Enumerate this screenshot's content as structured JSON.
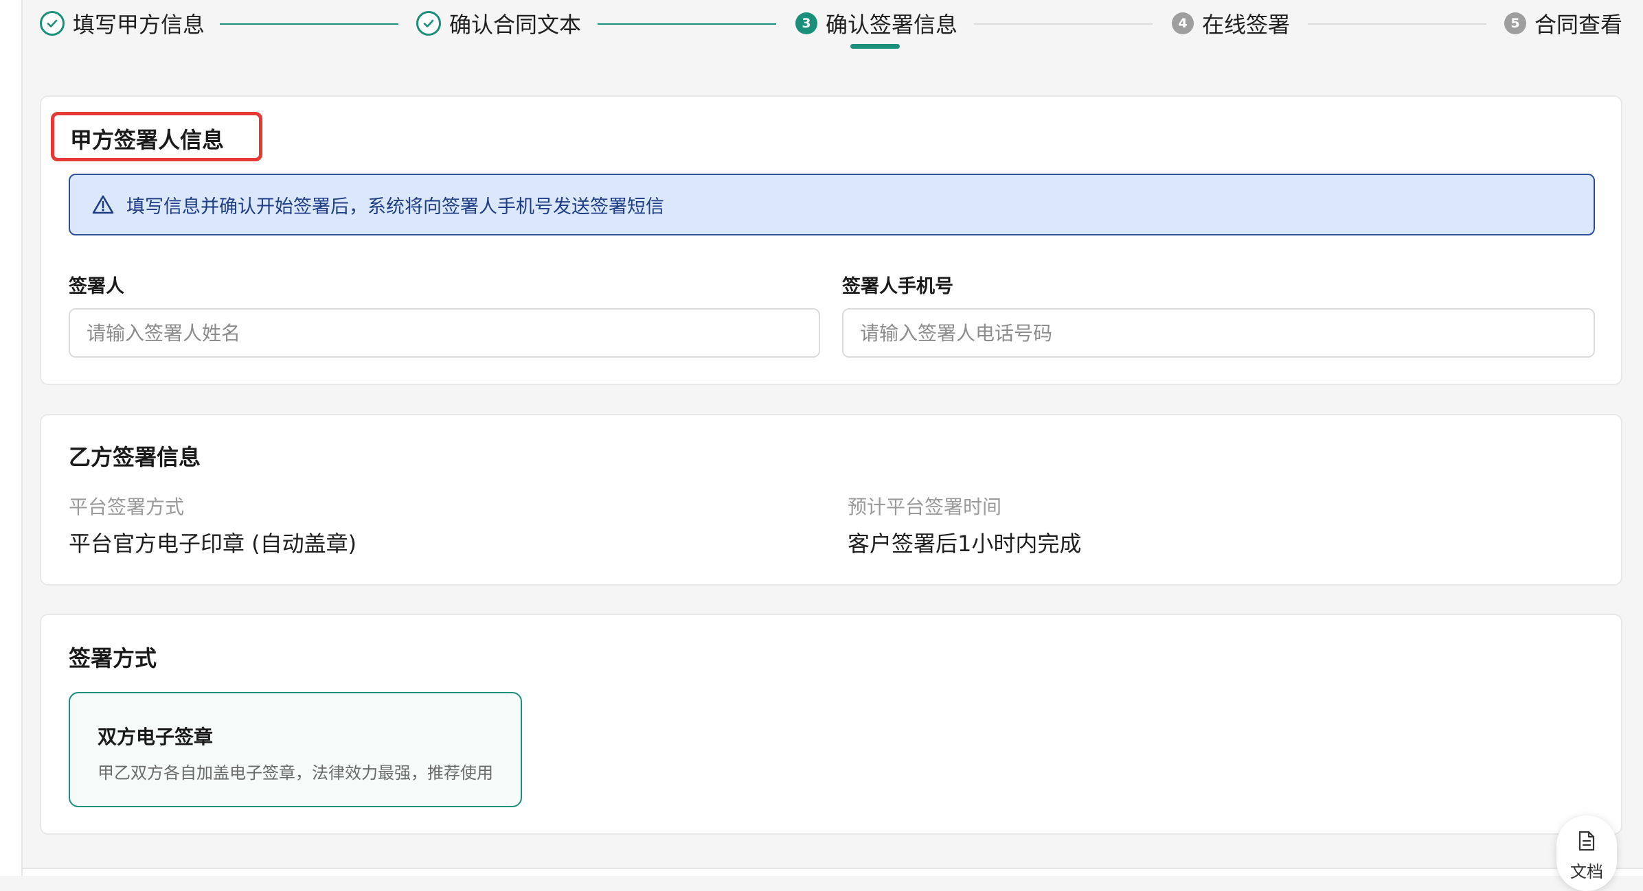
{
  "stepper": {
    "steps": [
      {
        "label": "填写甲方信息",
        "status": "done"
      },
      {
        "label": "确认合同文本",
        "status": "done"
      },
      {
        "label": "确认签署信息",
        "status": "active",
        "number": "3"
      },
      {
        "label": "在线签署",
        "status": "pending",
        "number": "4"
      },
      {
        "label": "合同查看",
        "status": "pending",
        "number": "5"
      }
    ]
  },
  "party_a": {
    "title": "甲方签署人信息",
    "alert_text": "填写信息并确认开始签署后，系统将向签署人手机号发送签署短信",
    "signer_label": "签署人",
    "signer_placeholder": "请输入签署人姓名",
    "signer_value": "",
    "phone_label": "签署人手机号",
    "phone_placeholder": "请输入签署人电话号码",
    "phone_value": ""
  },
  "party_b": {
    "title": "乙方签署信息",
    "method_label": "平台签署方式",
    "method_value": "平台官方电子印章 (自动盖章)",
    "time_label": "预计平台签署时间",
    "time_value": "客户签署后1小时内完成"
  },
  "signing_method": {
    "title": "签署方式",
    "option_title": "双方电子签章",
    "option_desc": "甲乙双方各自加盖电子签章，法律效力最强，推荐使用",
    "option_selected": true
  },
  "doc_button": {
    "label": "文档"
  },
  "colors": {
    "accent": "#1a8f7a",
    "highlight_border": "#e53935",
    "alert_bg": "#dbe8fb",
    "alert_text": "#1f3d85",
    "pending_step": "#9e9e9e"
  }
}
